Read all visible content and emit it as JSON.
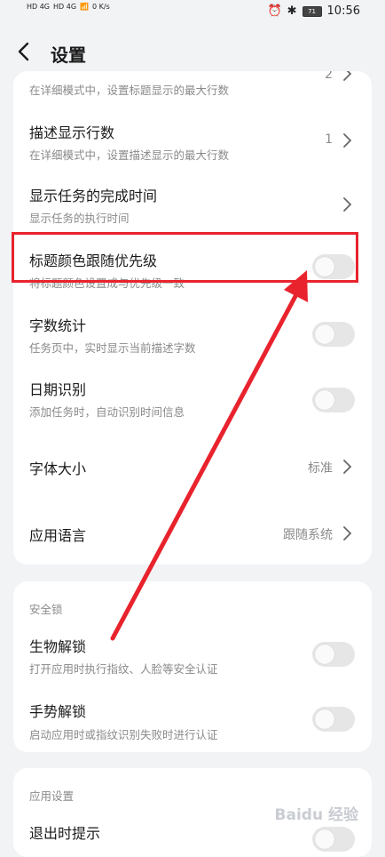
{
  "status_bar": {
    "net1": "HD 4G",
    "net2": "HD 4G",
    "speed": "0 K/s",
    "battery": "71",
    "time": "10:56"
  },
  "header": {
    "title": "设置"
  },
  "card1": {
    "rows": [
      {
        "title": "",
        "subtitle": "在详细模式中，设置标题显示的最大行数",
        "value": "2"
      },
      {
        "title": "描述显示行数",
        "subtitle": "在详细模式中，设置描述显示的最大行数",
        "value": "1"
      },
      {
        "title": "显示任务的完成时间",
        "subtitle": "显示任务的执行时间"
      },
      {
        "title": "标题颜色跟随优先级",
        "subtitle": "将标题颜色设置成与优先级一致"
      },
      {
        "title": "字数统计",
        "subtitle": "任务页中，实时显示当前描述字数"
      },
      {
        "title": "日期识别",
        "subtitle": "添加任务时，自动识别时间信息"
      },
      {
        "title": "字体大小",
        "value": "标准"
      },
      {
        "title": "应用语言",
        "value": "跟随系统"
      }
    ]
  },
  "card2": {
    "label": "安全锁",
    "rows": [
      {
        "title": "生物解锁",
        "subtitle": "打开应用时执行指纹、人脸等安全认证"
      },
      {
        "title": "手势解锁",
        "subtitle": "启动应用时或指纹识别失败时进行认证"
      }
    ]
  },
  "card3": {
    "label": "应用设置",
    "rows": [
      {
        "title": "退出时提示"
      }
    ]
  },
  "toggles": {
    "title_color": false,
    "word_count": false,
    "date_recognition": false,
    "biometric_unlock": false,
    "gesture_unlock": false,
    "exit_prompt": false
  },
  "annotation": {
    "color": "#e8232d"
  },
  "watermark": "Baidu 经验"
}
